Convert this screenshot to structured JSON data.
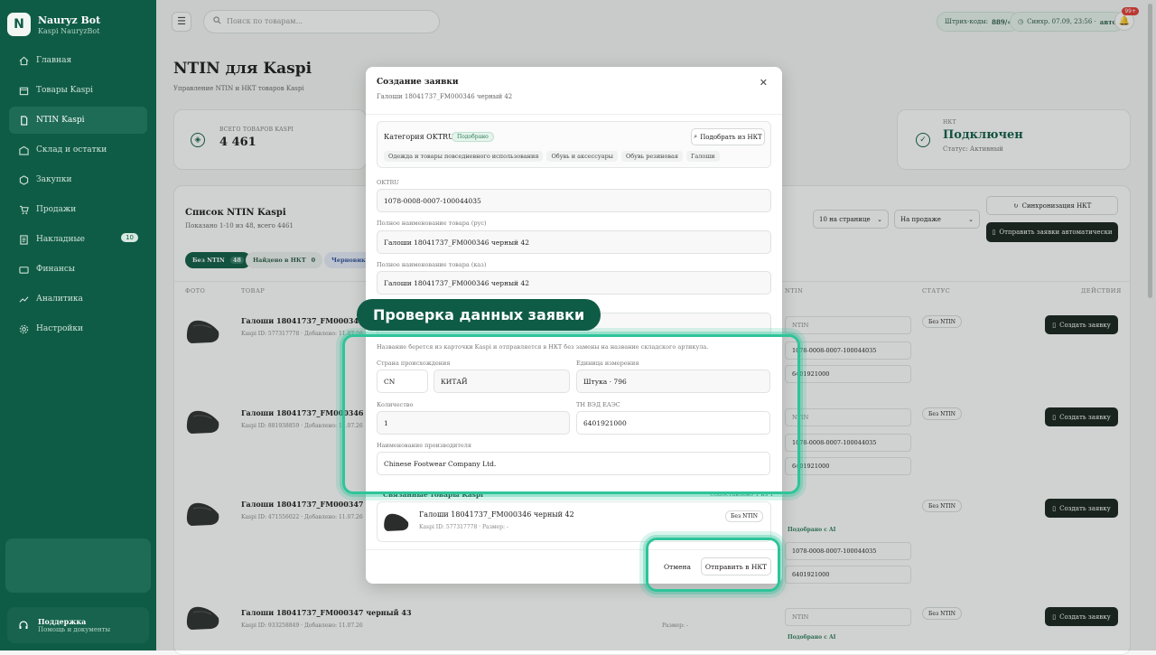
{
  "brand": {
    "name": "Nauryz Bot",
    "sub": "Kaspi NauryzBot"
  },
  "sidebar": {
    "items": [
      {
        "label": "Главная",
        "icon": "home-icon"
      },
      {
        "label": "Товары Kaspi",
        "icon": "box-icon"
      },
      {
        "label": "NTIN Kaspi",
        "icon": "doc-icon"
      },
      {
        "label": "Склад и остатки",
        "icon": "warehouse-icon"
      },
      {
        "label": "Закупки",
        "icon": "package-icon"
      },
      {
        "label": "Продажи",
        "icon": "cart-icon"
      },
      {
        "label": "Накладные",
        "icon": "invoice-icon",
        "badge": "10"
      },
      {
        "label": "Финансы",
        "icon": "wallet-icon"
      },
      {
        "label": "Аналитика",
        "icon": "chart-icon"
      },
      {
        "label": "Настройки",
        "icon": "gear-icon"
      }
    ],
    "support_title": "Поддержка",
    "support_sub": "Помощь и документы"
  },
  "topbar": {
    "search_placeholder": "Поиск по товарам...",
    "barcodes_label": "Штрих-коды:",
    "barcodes_value": "889/∞",
    "sync_label": "Синхр. 07.09, 23:56 ·",
    "sync_mode": "авто",
    "notif_badge": "99+"
  },
  "page": {
    "title": "NTIN для Kaspi",
    "subtitle": "Управление NTIN и НКТ товаров Kaspi"
  },
  "stats": {
    "total_label": "ВСЕГО ТОВАРОВ KASPI",
    "total_value": "4 461",
    "nkt_label": "НКТ",
    "nkt_value": "Подключен",
    "nkt_status": "Статус: Активный"
  },
  "list": {
    "title": "Список NTIN Kaspi",
    "subtitle": "Показано 1-10 из 48, всего 4461",
    "per_page": "10 на странице",
    "sale_filter": "На продаже",
    "sync_btn": "Синхронизация НКТ",
    "auto_btn": "Отправить заявки автоматически",
    "tabs": [
      {
        "label": "Без NTIN",
        "count": "48"
      },
      {
        "label": "Найдено в НКТ",
        "count": "0"
      },
      {
        "label": "Черновики",
        "count": ""
      }
    ],
    "headers": {
      "photo": "ФОТО",
      "product": "ТОВАР",
      "ntin": "NTIN",
      "status": "СТАТУС",
      "actions": "ДЕЙСТВИЯ"
    },
    "rows": [
      {
        "title": "Галоши 18041737_FM000346 черный 42",
        "meta": "Kaspi ID: 577317778 · Добавлено: 11.07.26",
        "ntin_placeholder": "NTIN",
        "oktru": "1078-0008-0007-100044035",
        "tnved": "6401921000",
        "status": "Без NTIN",
        "action": "Создать заявку"
      },
      {
        "title": "Галоши 18041737_FM000346 черный 41",
        "meta": "Kaspi ID: 881938859 · Добавлено: 11.07.26",
        "ntin_placeholder": "NTIN",
        "oktru": "1078-0008-0007-100044035",
        "tnved": "6401921000",
        "status": "Без NTIN",
        "action": "Создать заявку"
      },
      {
        "title": "Галоши 18041737_FM000347 черный 44",
        "meta": "Kaspi ID: 471556022 · Добавлено: 11.07.26",
        "ai": "Подобрано с AI",
        "oktru": "1078-0008-0007-100044035",
        "tnved": "6401921000",
        "status": "Без NTIN",
        "action": "Создать заявку"
      },
      {
        "title": "Галоши 18041737_FM000347 черный 43",
        "meta": "Kaspi ID: 933258849 · Добавлено: 11.07.26",
        "ntin_placeholder": "NTIN",
        "ai": "Подобрано с AI",
        "size": "Размер: -",
        "status": "Без NTIN",
        "action": "Создать заявку"
      }
    ]
  },
  "modal": {
    "title": "Создание заявки",
    "subtitle": "Галоши 18041737_FM000346 черный 42",
    "category_label": "Категория OKTRU",
    "category_badge": "Подобрано",
    "pick_btn": "Подобрать из НКТ",
    "breadcrumbs": [
      "Одежда и товары повседневного использования",
      "Обувь и аксессуары",
      "Обувь резиновая",
      "Галоши"
    ],
    "oktru_label": "OKTRU",
    "oktru_value": "1078-0008-0007-100044035",
    "name_ru_label": "Полное наименование товара (рус)",
    "name_ru_value": "Галоши 18041737_FM000346 черный 42",
    "name_kz_label": "Полное наименование товара (каз)",
    "name_kz_value": "Галоши 18041737_FM000346 черный 42",
    "note": "Название берется из карточки Kaspi и отправляется в НКТ без замены на название складского артикула.",
    "country_label": "Страна происхождения",
    "country_code": "CN",
    "country_name": "КИТАЙ",
    "unit_label": "Единица измерения",
    "unit_value": "Штука · 796",
    "qty_label": "Количество",
    "qty_value": "1",
    "tnved_label": "ТН ВЭД ЕАЭС",
    "tnved_value": "6401921000",
    "maker_label": "Наименование производителя",
    "maker_value": "Chinese Footwear Company Ltd.",
    "linked_label": "Связанные товары Kaspi",
    "linked_count": "Сопоставлено 1 из 1",
    "linked_item_title": "Галоши 18041737_FM000346 черный 42",
    "linked_item_meta": "Kaspi ID: 577317778 · Размер: -",
    "linked_item_status": "Без NTIN",
    "cancel": "Отмена",
    "submit": "Отправить в НКТ"
  },
  "callout": "Проверка данных заявки",
  "colors": {
    "sidebar": "#0f5c46",
    "accent": "#2fc49a",
    "dark_button": "#15211c"
  }
}
